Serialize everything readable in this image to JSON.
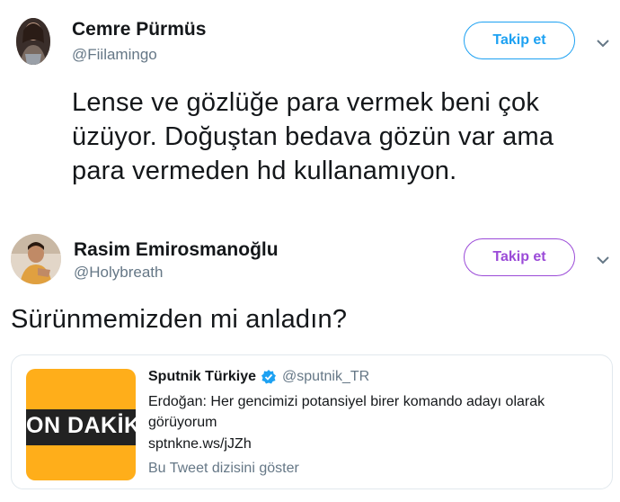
{
  "tweet1": {
    "display_name": "Cemre Pürmüs",
    "handle": "@Fiilamingo",
    "follow_label": "Takip et",
    "text_lines": [
      "Lense ve gözlüğe para vermek beni çok",
      "üzüyor. Doğuştan bedava gözün var ama",
      "para vermeden hd kullanamıyon."
    ]
  },
  "tweet2": {
    "display_name": "Rasim Emirosmanoğlu",
    "handle": "@Holybreath",
    "follow_label": "Takip et",
    "text": "Sürünmemizden mi anladın?",
    "quoted": {
      "display_name": "Sputnik Türkiye",
      "handle": "@sputnik_TR",
      "thumbnail_text": "ON DAKİK",
      "text_lines": [
        "Erdoğan: Her gencimizi potansiyel birer komando adayı olarak",
        "görüyorum"
      ],
      "link": "sptnkne.ws/jJZh",
      "footer": "Bu Tweet dizisini göster"
    }
  },
  "colors": {
    "follow_tweet1": "#1da1f2",
    "follow_tweet2": "#9b4bd8",
    "verified": "#1da1f2",
    "thumbnail_bg": "#ffae1a"
  },
  "icons": [
    "chevron-down-icon",
    "verified-badge-icon"
  ]
}
